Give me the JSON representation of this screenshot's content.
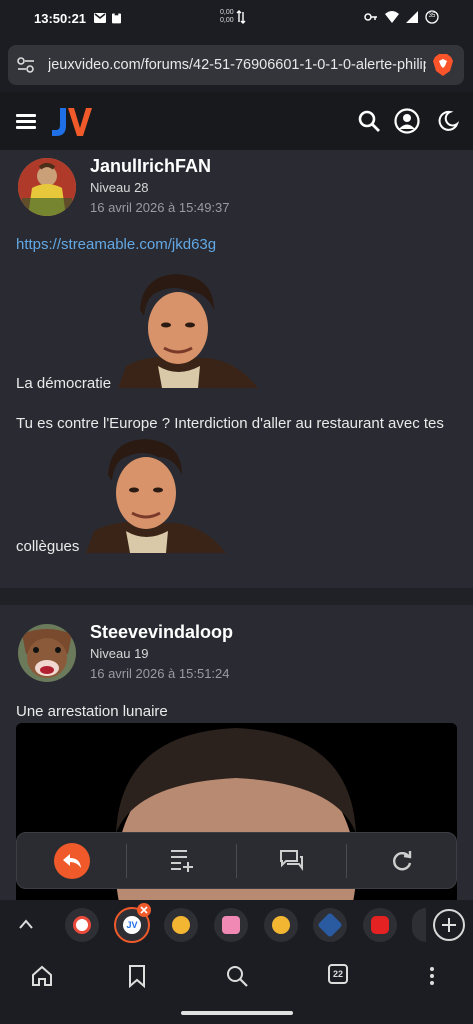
{
  "status": {
    "time": "13:50:21",
    "net_up": "0,00",
    "net_down": "0,00",
    "battery": "35"
  },
  "browser": {
    "url": "jeuxvideo.com/forums/42-51-76906601-1-0-1-0-alerte-philip",
    "tab_count": "22"
  },
  "posts": [
    {
      "pseudo": "JanulIrichFAN",
      "level": "Niveau 28",
      "date": "16 avril 2026 à 15:49:37",
      "link": "https://streamable.com/jkd63g",
      "line1": "La démocratie",
      "line2": "Tu es contre l'Europe ? Interdiction d'aller au restaurant avec tes",
      "line3": "collègues"
    },
    {
      "pseudo": "Steevevindaloop",
      "level": "Niveau 19",
      "date": "16 avril 2026 à 15:51:24",
      "line1": "Une arrestation lunaire"
    }
  ],
  "colors": {
    "accent": "#f05a2a",
    "link": "#62a8e5",
    "background": "#202127",
    "post_bg": "#2a2b32"
  }
}
